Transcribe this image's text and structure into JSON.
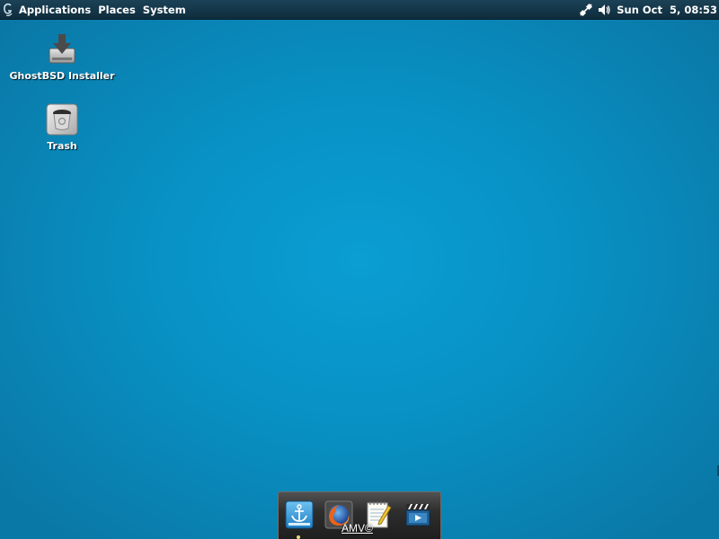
{
  "top_panel": {
    "logo_icon": "ghostbsd-logo-icon",
    "menus": [
      "Applications",
      "Places",
      "System"
    ],
    "tray_icons": [
      "network-icon",
      "volume-icon"
    ],
    "clock": "Sun Oct  5, 08:53"
  },
  "desktop": {
    "background_color": "#0993c6",
    "icons": [
      {
        "label": "GhostBSD Installer",
        "icon": "installer-drive-icon"
      },
      {
        "label": "Trash",
        "icon": "trash-icon"
      }
    ]
  },
  "dock": {
    "items": [
      {
        "name": "anchor-launcher-icon"
      },
      {
        "name": "firefox-icon"
      },
      {
        "name": "text-editor-icon"
      },
      {
        "name": "media-player-icon"
      }
    ],
    "watermark": "AMV©"
  }
}
